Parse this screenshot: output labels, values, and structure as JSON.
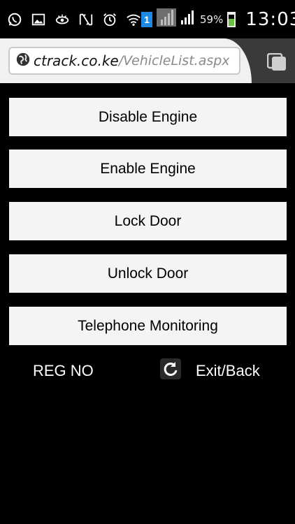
{
  "status_bar": {
    "sim_badge": "1",
    "battery_percent": "59%",
    "battery_level": 0.59,
    "clock": "13:03",
    "left_icons": [
      "whatsapp-icon",
      "gallery-icon",
      "eye-icon",
      "nfc-icon",
      "alarm-icon",
      "wifi-icon"
    ]
  },
  "browser": {
    "url_domain": "ctrack.co.ke",
    "url_path": "/VehicleList.aspx"
  },
  "actions": [
    {
      "label": "Disable Engine"
    },
    {
      "label": "Enable Engine"
    },
    {
      "label": "Lock Door"
    },
    {
      "label": "Unlock Door"
    },
    {
      "label": "Telephone Monitoring"
    }
  ],
  "footer": {
    "reg_no": "REG NO",
    "exit_back": "Exit/Back"
  },
  "colors": {
    "background": "#000000",
    "button_bg": "#f4f4f4",
    "browser_bar": "#3a3a3a",
    "url_path": "#8a8a8a",
    "battery_fill": "#6abf3e",
    "sim_badge": "#1e88e5"
  }
}
